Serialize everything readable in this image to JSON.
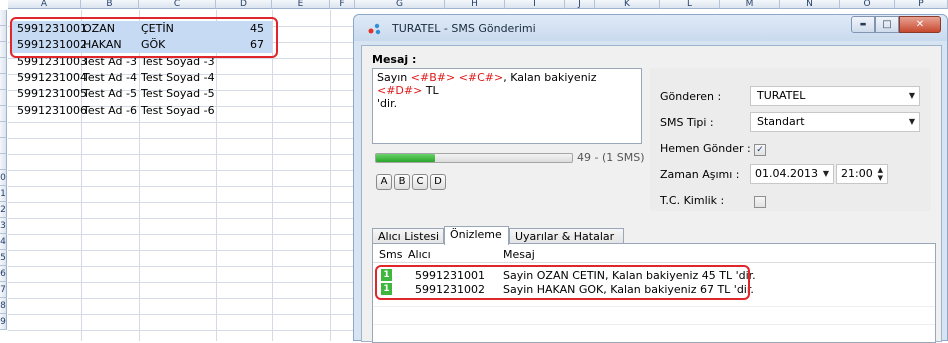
{
  "sheet": {
    "columns": [
      "A",
      "B",
      "C",
      "D",
      "E",
      "F",
      "G",
      "H",
      "I",
      "J",
      "K",
      "L",
      "M",
      "N",
      "O",
      "P"
    ],
    "row_labels": [
      "0",
      "1",
      "2",
      "3",
      "4",
      "5",
      "6",
      "7",
      "8",
      "9"
    ],
    "rows": [
      {
        "a": "5991231001",
        "b": "OZAN",
        "c": "ÇETİN",
        "d": "45"
      },
      {
        "a": "5991231002",
        "b": "HAKAN",
        "c": "GÖK",
        "d": "67"
      },
      {
        "a": "5991231003",
        "b": "Test Ad -3",
        "c": "Test Soyad -3",
        "d": ""
      },
      {
        "a": "5991231004",
        "b": "Test Ad -4",
        "c": "Test Soyad -4",
        "d": ""
      },
      {
        "a": "5991231005",
        "b": "Test Ad -5",
        "c": "Test Soyad -5",
        "d": ""
      },
      {
        "a": "5991231006",
        "b": "Test Ad -6",
        "c": "Test Soyad -6",
        "d": ""
      }
    ]
  },
  "dialog": {
    "title": "TURATEL - SMS Gönderimi",
    "window_buttons": {
      "minimize": "▬",
      "maximize": "□",
      "close": "✕"
    },
    "message_label": "Mesaj :",
    "message": {
      "t1": "Sayın ",
      "v1": "<#B#>",
      "t2": " ",
      "v2": "<#C#>",
      "t3": ", Kalan bakiyeniz ",
      "v3": "<#D#>",
      "t4": " TL",
      "line2": "'dir."
    },
    "progress": {
      "fraction": 0.3,
      "text": "49 - (1 SMS)"
    },
    "var_buttons": [
      "A",
      "B",
      "C",
      "D"
    ],
    "fields": {
      "sender_label": "Gönderen :",
      "sender_value": "TURATEL",
      "sms_type_label": "SMS Tipi :",
      "sms_type_value": "Standart",
      "send_now_label": "Hemen Gönder :",
      "send_now_checked": "✓",
      "timeout_label": "Zaman Aşımı :",
      "timeout_date": "01.04.2013",
      "timeout_time": "21:00",
      "tc_label": "T.C. Kimlik :"
    },
    "tabs": [
      "Alıcı Listesi",
      "Önizleme",
      "Uyarılar & Hatalar"
    ],
    "preview": {
      "headers": {
        "sms": "Sms",
        "recipient": "Alıcı",
        "message": "Mesaj"
      },
      "rows": [
        {
          "sms": "1",
          "recipient": "5991231001",
          "message": "Sayin OZAN CETIN, Kalan bakiyeniz 45 TL 'dir."
        },
        {
          "sms": "1",
          "recipient": "5991231002",
          "message": "Sayin HAKAN GOK, Kalan bakiyeniz 67 TL 'dir."
        }
      ]
    }
  },
  "colors": {
    "highlight": "#e0262b",
    "selection": "#c6daf3",
    "accent": "#3fb73f"
  }
}
